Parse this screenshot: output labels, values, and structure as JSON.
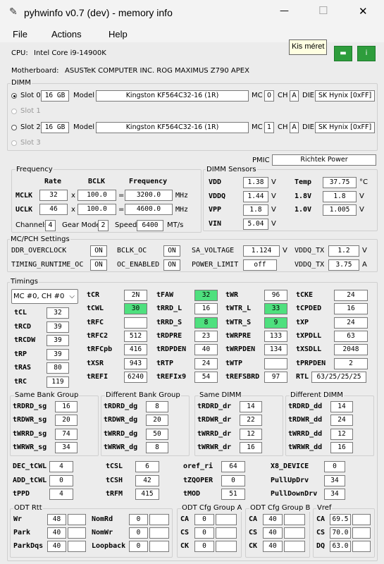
{
  "window": {
    "title": "pyhwinfo v0.7 (dev) - memory info",
    "minimize": "—",
    "maximize": "☐",
    "close": "✕"
  },
  "menu": [
    "File",
    "Actions",
    "Help"
  ],
  "tooltip": "Kis méret",
  "header": {
    "cpu_label": "CPU:",
    "cpu": "Intel Core i9-14900K",
    "mb_label": "Motherboard:",
    "mb": "ASUSTeK COMPUTER INC. ROG MAXIMUS Z790 APEX"
  },
  "dimm": {
    "title": "DIMM",
    "model_label": "Model",
    "mc_label": "MC",
    "ch_label": "CH",
    "die_label": "DIE",
    "slots": [
      {
        "name": "Slot 0",
        "size": "16 GB",
        "model": "Kingston  KF564C32-16  (1R)",
        "mc": "0",
        "ch": "A",
        "die": "SK Hynix [0xFF]"
      },
      {
        "name": "Slot 1"
      },
      {
        "name": "Slot 2",
        "size": "16 GB",
        "model": "Kingston  KF564C32-16  (1R)",
        "mc": "1",
        "ch": "A",
        "die": "SK Hynix [0xFF]"
      },
      {
        "name": "Slot 3"
      }
    ]
  },
  "pmic": {
    "label": "PMIC",
    "value": "Richtek Power"
  },
  "frequency": {
    "title": "Frequency",
    "h_rate": "Rate",
    "h_bclk": "BCLK",
    "h_freq": "Frequency",
    "x": "x",
    "eq": "=",
    "mhz": "MHz",
    "mclk": {
      "label": "MCLK",
      "rate": "32",
      "bclk": "100.0",
      "freq": "3200.0"
    },
    "uclk": {
      "label": "UCLK",
      "rate": "46",
      "bclk": "100.0",
      "freq": "4600.0"
    },
    "channels_label": "Channels",
    "channels": "4",
    "gearmode_label": "Gear Mode",
    "gearmode": "2",
    "speed_label": "Speed",
    "speed": "6400",
    "speed_unit": "MT/s"
  },
  "sensors": {
    "title": "DIMM Sensors",
    "vdd": {
      "label": "VDD",
      "value": "1.38",
      "unit": "V"
    },
    "vddq": {
      "label": "VDDQ",
      "value": "1.44",
      "unit": "V"
    },
    "vpp": {
      "label": "VPP",
      "value": "1.8",
      "unit": "V"
    },
    "vin": {
      "label": "VIN",
      "value": "5.04",
      "unit": "V"
    },
    "temp": {
      "label": "Temp",
      "value": "37.75",
      "unit": "°C"
    },
    "v18": {
      "label": "1.8V",
      "value": "1.8",
      "unit": "V"
    },
    "v10": {
      "label": "1.0V",
      "value": "1.005",
      "unit": "V"
    }
  },
  "mcpch": {
    "title": "MC/PCH Settings",
    "ddr_oc": {
      "label": "DDR_OVERCLOCK",
      "value": "ON"
    },
    "bclk_oc": {
      "label": "BCLK_OC",
      "value": "ON"
    },
    "sa_v": {
      "label": "SA_VOLTAGE",
      "value": "1.124",
      "unit": "V"
    },
    "vddq_tx1": {
      "label": "VDDQ_TX",
      "value": "1.2",
      "unit": "V"
    },
    "trt_oc": {
      "label": "TIMING_RUNTIME_OC",
      "value": "ON"
    },
    "oc_en": {
      "label": "OC_ENABLED",
      "value": "ON"
    },
    "pl": {
      "label": "POWER_LIMIT",
      "value": "off"
    },
    "vddq_tx2": {
      "label": "VDDQ_TX",
      "value": "3.75",
      "unit": "A"
    }
  },
  "timings": {
    "title": "Timings",
    "select": "MC #0, CH #0",
    "left": [
      [
        "tCL",
        "32"
      ],
      [
        "tRCD",
        "39"
      ],
      [
        "tRCDW",
        "39"
      ],
      [
        "tRP",
        "39"
      ],
      [
        "tRAS",
        "80"
      ],
      [
        "tRC",
        "119"
      ]
    ],
    "cols": [
      [
        [
          "tCR",
          "2N"
        ],
        [
          "tCWL",
          "30"
        ],
        [
          "tRFC",
          ""
        ],
        [
          "tRFC2",
          "512"
        ],
        [
          "tRFCpb",
          "416"
        ],
        [
          "tXSR",
          "943"
        ],
        [
          "tREFI",
          "6240"
        ]
      ],
      [
        [
          "tFAW",
          "32"
        ],
        [
          "tRRD_L",
          "16"
        ],
        [
          "tRRD_S",
          "8"
        ],
        [
          "tRDPRE",
          "23"
        ],
        [
          "tRDPDEN",
          "40"
        ],
        [
          "tRTP",
          "24"
        ],
        [
          "tREFIx9",
          "54"
        ]
      ],
      [
        [
          "tWR",
          "96"
        ],
        [
          "tWTR_L",
          "33"
        ],
        [
          "tWTR_S",
          "9"
        ],
        [
          "tWRPRE",
          "133"
        ],
        [
          "tWRPDEN",
          "134"
        ],
        [
          "tWTP",
          ""
        ],
        [
          "tREFSBRD",
          "97"
        ]
      ],
      [
        [
          "tCKE",
          "24"
        ],
        [
          "tCPDED",
          "16"
        ],
        [
          "tXP",
          "24"
        ],
        [
          "tXPDLL",
          "63"
        ],
        [
          "tXSDLL",
          "2048"
        ],
        [
          "tPRPDEN",
          "2"
        ],
        [
          "RTL",
          "63/25/25/25"
        ]
      ]
    ]
  },
  "groups": [
    {
      "title": "Same Bank Group",
      "rows": [
        [
          "tRDRD_sg",
          "16"
        ],
        [
          "tRDWR_sg",
          "20"
        ],
        [
          "tWRRD_sg",
          "74"
        ],
        [
          "tWRWR_sg",
          "34"
        ]
      ]
    },
    {
      "title": "Different Bank Group",
      "rows": [
        [
          "tRDRD_dg",
          "8"
        ],
        [
          "tRDWR_dg",
          "20"
        ],
        [
          "tWRRD_dg",
          "50"
        ],
        [
          "tWRWR_dg",
          "8"
        ]
      ]
    },
    {
      "title": "Same DIMM",
      "rows": [
        [
          "tRDRD_dr",
          "14"
        ],
        [
          "tRDWR_dr",
          "22"
        ],
        [
          "tWRRD_dr",
          "12"
        ],
        [
          "tWRWR_dr",
          "16"
        ]
      ]
    },
    {
      "title": "Different DIMM",
      "rows": [
        [
          "tRDRD_dd",
          "14"
        ],
        [
          "tRDWR_dd",
          "24"
        ],
        [
          "tWRRD_dd",
          "12"
        ],
        [
          "tWRWR_dd",
          "16"
        ]
      ]
    }
  ],
  "misc": [
    [
      [
        "DEC_tCWL",
        "4"
      ],
      [
        "ADD_tCWL",
        "0"
      ],
      [
        "tPPD",
        "4"
      ]
    ],
    [
      [
        "tCSL",
        "6"
      ],
      [
        "tCSH",
        "42"
      ],
      [
        "tRFM",
        "415"
      ]
    ],
    [
      [
        "oref_ri",
        "64"
      ],
      [
        "tZQOPER",
        "0"
      ],
      [
        "tMOD",
        "51"
      ]
    ],
    [
      [
        "X8_DEVICE",
        "0"
      ],
      [
        "PullUpDrv",
        "34"
      ],
      [
        "PullDownDrv",
        "34"
      ]
    ]
  ],
  "odt": {
    "title": "ODT Rtt",
    "rows": [
      [
        "Wr",
        "48",
        "NomRd",
        "0"
      ],
      [
        "Park",
        "40",
        "NomWr",
        "0"
      ],
      [
        "ParkDqs",
        "40",
        "Loopback",
        "0"
      ]
    ]
  },
  "odta": {
    "title": "ODT Cfg Group A",
    "rows": [
      [
        "CA",
        "0"
      ],
      [
        "CS",
        "0"
      ],
      [
        "CK",
        "0"
      ]
    ]
  },
  "odtb": {
    "title": "ODT Cfg Group B",
    "rows": [
      [
        "CA",
        "40"
      ],
      [
        "CS",
        "40"
      ],
      [
        "CK",
        "40"
      ]
    ]
  },
  "vref": {
    "title": "Vref",
    "rows": [
      [
        "CA",
        "69.5"
      ],
      [
        "CS",
        "70.0"
      ],
      [
        "DQ",
        "63.0"
      ]
    ]
  }
}
